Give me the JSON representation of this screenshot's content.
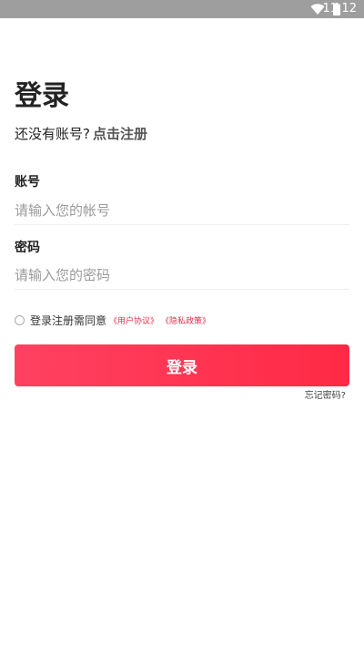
{
  "status_bar": {
    "time": "11:12",
    "wifi_icon": "wifi-icon",
    "battery_icon": "battery-icon"
  },
  "login": {
    "title": "登录",
    "no_account_text": "还没有账号?",
    "register_link": "点击注册",
    "account_label": "账号",
    "account_placeholder": "请输入您的帐号",
    "password_label": "密码",
    "password_placeholder": "请输入您的密码",
    "agree_text": "登录注册需同意",
    "user_agreement": "《用户协议》",
    "privacy_policy": "《隐私政策》",
    "login_button": "登录",
    "forgot_password": "忘记密码?"
  },
  "colors": {
    "accent": "#ff3250",
    "status_bar": "#9e9e9e"
  }
}
